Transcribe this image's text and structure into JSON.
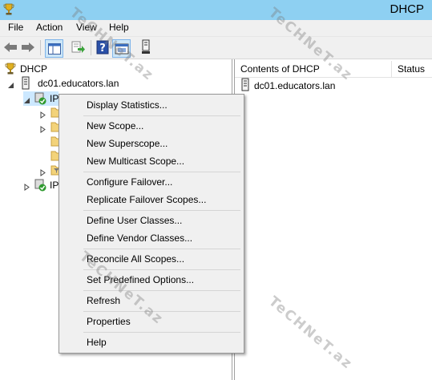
{
  "window": {
    "title": "DHCP"
  },
  "menubar": {
    "items": [
      "File",
      "Action",
      "View",
      "Help"
    ]
  },
  "toolbar": {
    "buttons": [
      "back-arrow-icon",
      "forward-arrow-icon",
      "show-hide-console-tree-icon",
      "export-list-icon",
      "help-icon",
      "properties-icon",
      "server-icon"
    ]
  },
  "tree": {
    "root": "DHCP",
    "server": "dc01.educators.lan",
    "ipv4_partial": "IP",
    "ipv6_partial": "IP"
  },
  "list": {
    "col_contents": "Contents of DHCP",
    "col_status": "Status",
    "rows": [
      "dc01.educators.lan"
    ]
  },
  "context_menu": {
    "items": [
      "Display Statistics...",
      "New Scope...",
      "New Superscope...",
      "New Multicast Scope...",
      "Configure Failover...",
      "Replicate Failover Scopes...",
      "Define User Classes...",
      "Define Vendor Classes...",
      "Reconcile All Scopes...",
      "Set Predefined Options...",
      "Refresh",
      "Properties",
      "Help"
    ]
  },
  "watermark": {
    "text": "TeCHNeT.az"
  }
}
